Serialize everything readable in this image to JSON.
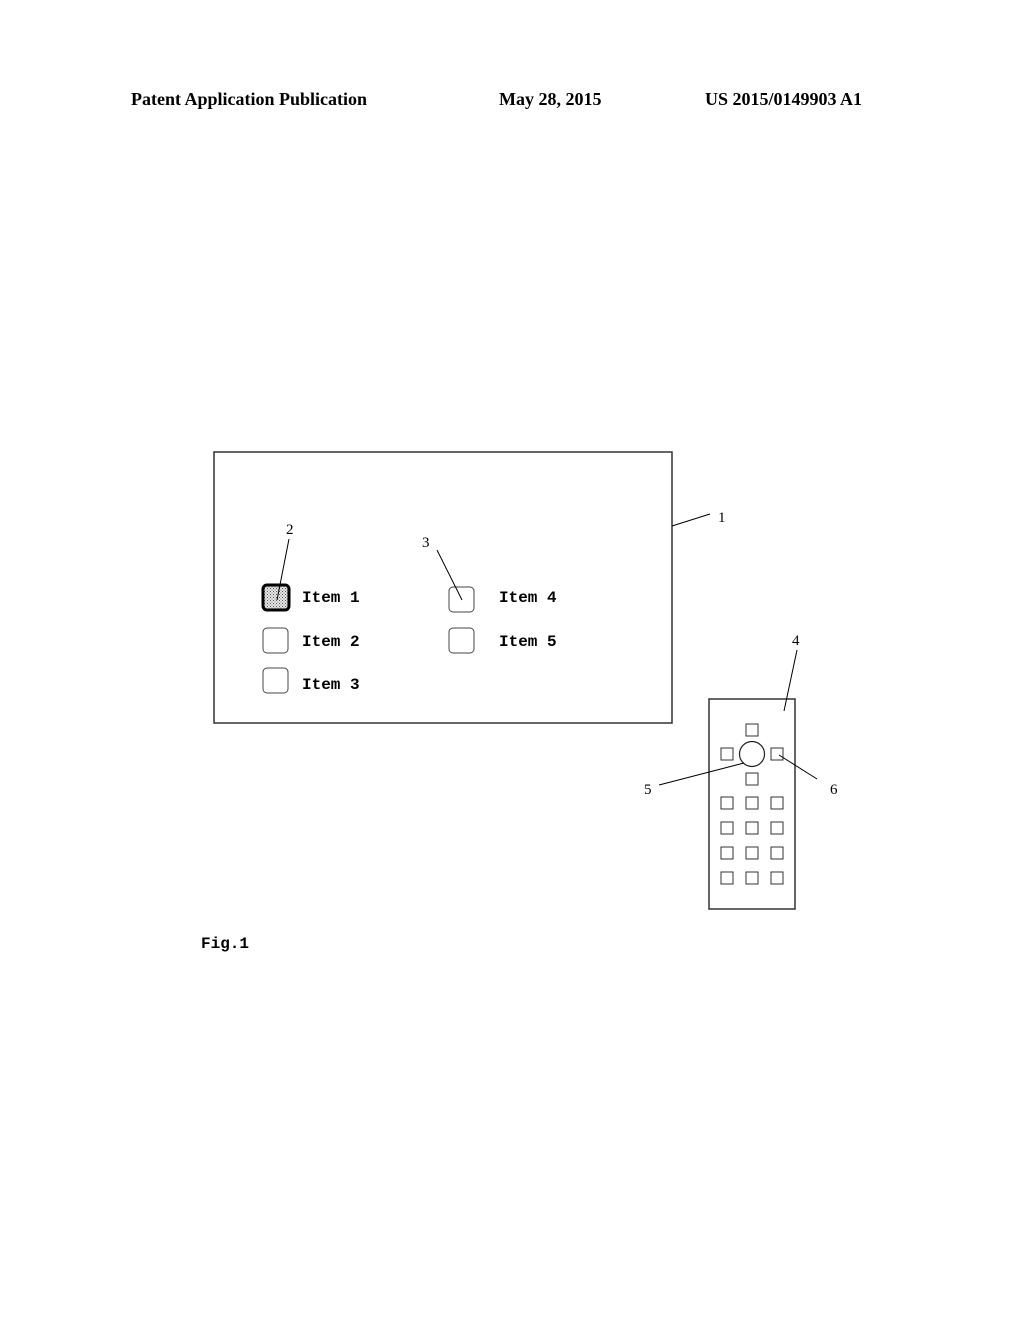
{
  "header": {
    "left": "Patent Application Publication",
    "date": "May 28, 2015",
    "number": "US 2015/0149903 A1"
  },
  "screen": {
    "items": [
      {
        "label": "Item 1",
        "selected": true
      },
      {
        "label": "Item 2",
        "selected": false
      },
      {
        "label": "Item 3",
        "selected": false
      },
      {
        "label": "Item 4",
        "selected": false
      },
      {
        "label": "Item 5",
        "selected": false
      }
    ]
  },
  "remote": {
    "keypad_rows": 4,
    "keypad_cols": 3,
    "center_button": "circle"
  },
  "reference_numerals": {
    "screen": "1",
    "selected_item": "2",
    "item_checkbox": "3",
    "remote": "4",
    "ok_button": "5",
    "direction_button": "6"
  },
  "figure_label": "Fig.1"
}
